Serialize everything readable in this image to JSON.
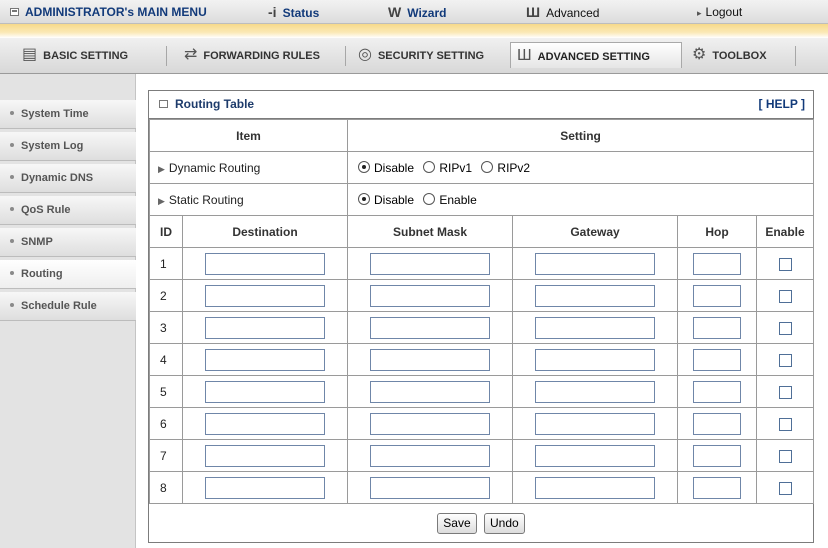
{
  "topbar": {
    "main_menu": "ADMINISTRATOR's MAIN MENU",
    "status": "Status",
    "wizard": "Wizard",
    "advanced": "Advanced",
    "logout": "Logout"
  },
  "tabs": {
    "basic": "BASIC SETTING",
    "forwarding": "FORWARDING RULES",
    "security": "SECURITY SETTING",
    "advanced": "ADVANCED SETTING",
    "toolbox": "TOOLBOX"
  },
  "sidebar": {
    "items": [
      {
        "label": "System Time"
      },
      {
        "label": "System Log"
      },
      {
        "label": "Dynamic DNS"
      },
      {
        "label": "QoS Rule"
      },
      {
        "label": "SNMP"
      },
      {
        "label": "Routing"
      },
      {
        "label": "Schedule Rule"
      }
    ]
  },
  "panel": {
    "title": "Routing Table",
    "help": "[ HELP ]",
    "header_item": "Item",
    "header_setting": "Setting",
    "dynamic_routing": {
      "label": "Dynamic Routing",
      "options": [
        "Disable",
        "RIPv1",
        "RIPv2"
      ],
      "selected": "Disable"
    },
    "static_routing": {
      "label": "Static Routing",
      "options": [
        "Disable",
        "Enable"
      ],
      "selected": "Disable"
    },
    "columns": {
      "id": "ID",
      "destination": "Destination",
      "subnet_mask": "Subnet Mask",
      "gateway": "Gateway",
      "hop": "Hop",
      "enable": "Enable"
    },
    "row_ids": [
      "1",
      "2",
      "3",
      "4",
      "5",
      "6",
      "7",
      "8"
    ],
    "save": "Save",
    "undo": "Undo"
  }
}
